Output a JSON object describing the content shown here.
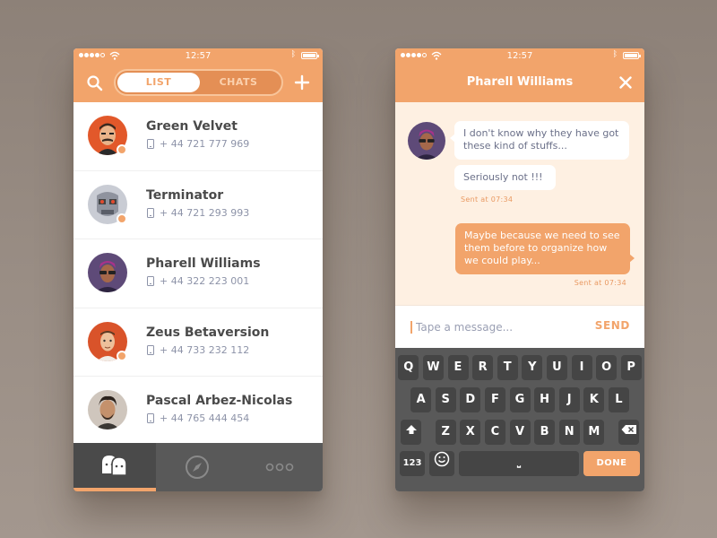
{
  "colors": {
    "accent": "#f2a46b",
    "accent_dark": "#e48f55",
    "dark": "#595959",
    "text": "#4a4a4a",
    "muted": "#8d93a8",
    "chat_bg": "#fef0e2"
  },
  "status_bar": {
    "time": "12:57"
  },
  "list_screen": {
    "tabs": [
      {
        "label": "LIST",
        "active": true
      },
      {
        "label": "CHATS",
        "active": false
      }
    ],
    "contacts": [
      {
        "name": "Green Velvet",
        "phone": "+ 44 721 777 969",
        "online": true
      },
      {
        "name": "Terminator",
        "phone": "+ 44 721 293 993",
        "online": true
      },
      {
        "name": "Pharell Williams",
        "phone": "+ 44 322 223 001",
        "online": false
      },
      {
        "name": "Zeus Betaversion",
        "phone": "+ 44 733 232 112",
        "online": true
      },
      {
        "name": "Pascal Arbez-Nicolas",
        "phone": "+ 44 765 444 454",
        "online": false
      }
    ],
    "bottom_tabs": [
      {
        "icon": "contacts-icon",
        "active": true
      },
      {
        "icon": "compass-icon",
        "active": false
      },
      {
        "icon": "more-icon",
        "active": false
      }
    ]
  },
  "chat_screen": {
    "title": "Pharell Williams",
    "messages": [
      {
        "direction": "in",
        "text": "I don't know why they have got these kind of stuffs..."
      },
      {
        "direction": "in",
        "text": "Seriously not !!!"
      },
      {
        "direction": "out",
        "text": "Maybe because we need to see them before to organize how we could play..."
      }
    ],
    "sent_labels": [
      "Sent at   07:34",
      "Sent at   07:34"
    ],
    "composer": {
      "placeholder": "Tape a message...",
      "send_label": "SEND"
    },
    "keyboard": {
      "row1": [
        "Q",
        "W",
        "E",
        "R",
        "T",
        "Y",
        "U",
        "I",
        "O",
        "P"
      ],
      "row2": [
        "A",
        "S",
        "D",
        "F",
        "G",
        "H",
        "J",
        "K",
        "L"
      ],
      "row3": [
        "Z",
        "X",
        "C",
        "V",
        "B",
        "N",
        "M"
      ],
      "numbers_label": "123",
      "space_label": "⎵",
      "done_label": "DONE"
    }
  }
}
